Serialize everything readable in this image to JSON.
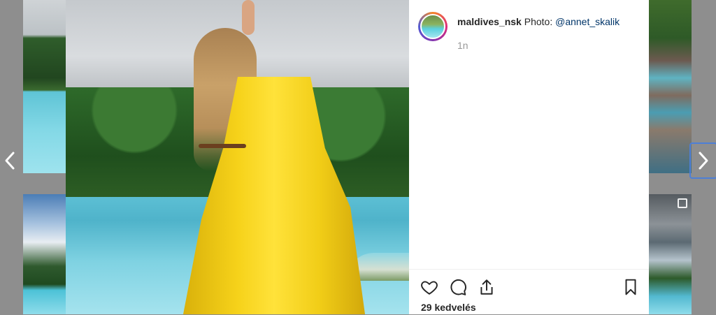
{
  "post": {
    "username": "maldives_nsk",
    "caption_prefix": "Photo:",
    "mention": "@annet_skalik",
    "time": "1n",
    "likes": "29 kedvelés"
  },
  "icons": {
    "prev": "chevron-left-icon",
    "next": "chevron-right-icon",
    "like": "heart-icon",
    "comment": "comment-icon",
    "share": "share-icon",
    "save": "bookmark-icon",
    "multi": "multiple-photos-icon"
  },
  "colors": {
    "mention": "#003569",
    "overlay": "#8e8e8e",
    "focus_outline": "#4d7fd6"
  }
}
